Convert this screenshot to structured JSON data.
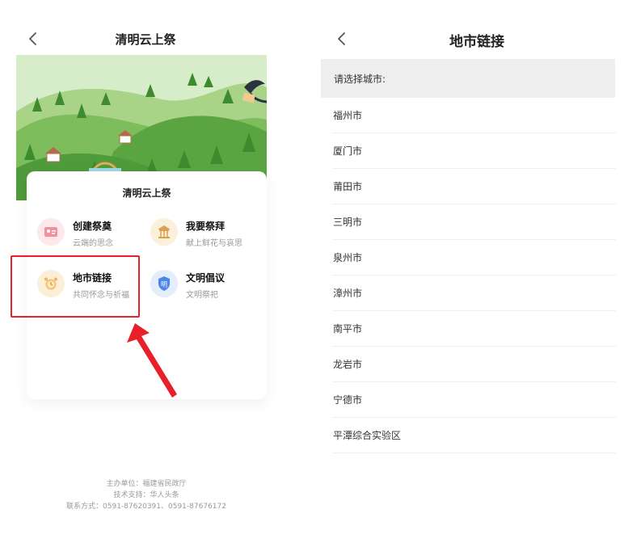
{
  "left": {
    "nav_title": "清明云上祭",
    "card_title": "清明云上祭",
    "tiles": [
      {
        "name": "创建祭奠",
        "sub": "云端的思念",
        "icon": "photo-card-icon",
        "color": "#f7a7b4",
        "bg": "#fde9ec"
      },
      {
        "name": "我要祭拜",
        "sub": "献上鲜花与哀思",
        "icon": "shrine-icon",
        "color": "#e6b36a",
        "bg": "#fbf0dc"
      },
      {
        "name": "地市链接",
        "sub": "共同怀念与祈福",
        "icon": "alarm-clock-icon",
        "color": "#f2b25a",
        "bg": "#fcefd8"
      },
      {
        "name": "文明倡议",
        "sub": "文明祭祀",
        "icon": "shield-icon",
        "color": "#4a86e8",
        "bg": "#e3edfb",
        "glyph": "明"
      }
    ],
    "footer": [
      "主办单位：福建省民政厅",
      "技术支持：华人头条",
      "联系方式：0591-87620391、0591-87676172"
    ],
    "highlight_color": "#e8202a"
  },
  "right": {
    "nav_title": "地市链接",
    "prompt": "请选择城市:",
    "cities": [
      "福州市",
      "厦门市",
      "莆田市",
      "三明市",
      "泉州市",
      "漳州市",
      "南平市",
      "龙岩市",
      "宁德市",
      "平潭综合实验区"
    ]
  }
}
